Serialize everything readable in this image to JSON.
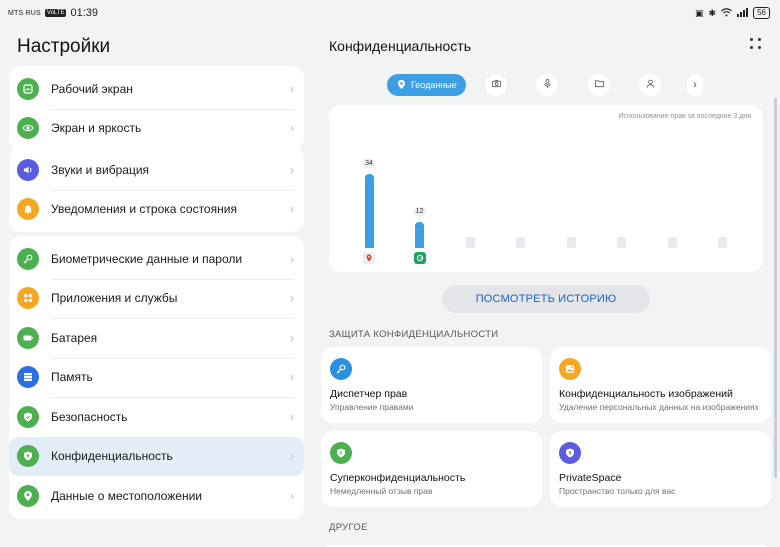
{
  "status": {
    "carrier": "MTS RUS",
    "volte": "VoLTE",
    "time": "01:39",
    "battery": "56"
  },
  "left": {
    "title": "Настройки",
    "groups": [
      {
        "items": [
          {
            "label": "Рабочий экран",
            "icon": "home-screen-icon",
            "color": "#4caf50"
          },
          {
            "label": "Экран и яркость",
            "icon": "eye-icon",
            "color": "#4caf50"
          }
        ]
      },
      {
        "items": [
          {
            "label": "Звуки и вибрация",
            "icon": "speaker-icon",
            "color": "#5b5de0"
          },
          {
            "label": "Уведомления и строка состояния",
            "icon": "bell-icon",
            "color": "#f5a623"
          }
        ]
      },
      {
        "items": [
          {
            "label": "Биометрические данные и пароли",
            "icon": "key-icon",
            "color": "#4caf50"
          },
          {
            "label": "Приложения и службы",
            "icon": "apps-grid-icon",
            "color": "#f5a623"
          },
          {
            "label": "Батарея",
            "icon": "battery-icon",
            "color": "#4caf50"
          },
          {
            "label": "Память",
            "icon": "storage-icon",
            "color": "#2b6fe3"
          },
          {
            "label": "Безопасность",
            "icon": "shield-check-icon",
            "color": "#4caf50"
          },
          {
            "label": "Конфиденциальность",
            "icon": "privacy-shield-icon",
            "color": "#4caf50",
            "active": true
          },
          {
            "label": "Данные о местоположении",
            "icon": "location-pin-icon",
            "color": "#4caf50"
          }
        ]
      }
    ]
  },
  "right": {
    "title": "Конфиденциальность",
    "tabs": [
      {
        "label": "Геоданные",
        "icon": "location-pin-icon",
        "selected": true
      },
      {
        "label": "",
        "icon": "camera-icon"
      },
      {
        "label": "",
        "icon": "microphone-icon"
      },
      {
        "label": "",
        "icon": "folder-icon"
      },
      {
        "label": "",
        "icon": "contacts-icon"
      },
      {
        "label": "",
        "icon": "chevron-right-icon"
      }
    ],
    "chart_note": "Использование прав за последние 3 дня",
    "history_button": "ПОСМОТРЕТЬ ИСТОРИЮ",
    "section_protection": "ЗАЩИТА КОНФИДЕНЦИАЛЬНОСТИ",
    "section_other": "ДРУГОЕ",
    "cards": [
      {
        "title": "Диспетчер прав",
        "subtitle": "Управление правами",
        "icon": "key-icon",
        "color": "#2b8fe0"
      },
      {
        "title": "Конфиденциальность изображений",
        "subtitle": "Удаление персональных данных на изображениях",
        "icon": "image-icon",
        "color": "#f5a623"
      },
      {
        "title": "Суперконфиденциальность",
        "subtitle": "Немедленный отзыв прав",
        "icon": "shield-icon",
        "color": "#4caf50"
      },
      {
        "title": "PrivateSpace",
        "subtitle": "Пространство только для вас",
        "icon": "private-space-icon",
        "color": "#5b5de0"
      }
    ]
  },
  "chart_data": {
    "type": "bar",
    "title": "",
    "categories": [
      "app-1",
      "app-2",
      "",
      "",
      "",
      "",
      "",
      ""
    ],
    "values": [
      34,
      12,
      0,
      0,
      0,
      0,
      0,
      0
    ],
    "data_labels": [
      "34",
      "12"
    ],
    "app_icon_colors": [
      "#e8eef7",
      "#1fa463"
    ],
    "ylim": [
      0,
      34
    ],
    "grid": false,
    "legend": "none"
  }
}
